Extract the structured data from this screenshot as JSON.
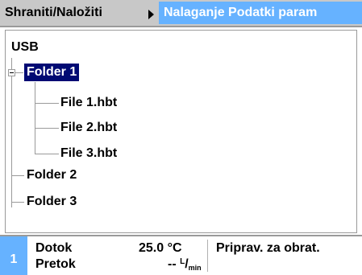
{
  "header": {
    "breadcrumb": "Shraniti/Naložiti",
    "active_tab": "Nalaganje Podatki param"
  },
  "tree": {
    "root": "USB",
    "folder1": "Folder 1",
    "files": [
      "File 1.hbt",
      "File 2.hbt",
      "File 3.hbt"
    ],
    "folder2": "Folder 2",
    "folder3": "Folder 3"
  },
  "status": {
    "channel": "1",
    "dotok_label": "Dotok",
    "dotok_value": "25.0 °C",
    "pretok_label": "Pretok",
    "pretok_value": "--",
    "pretok_unit_num": "L",
    "pretok_unit_den": "min",
    "message": "Priprav. za obrat."
  },
  "colors": {
    "header_bg": "#c8c8c8",
    "accent": "#66b2ff",
    "selection": "#000a73"
  }
}
